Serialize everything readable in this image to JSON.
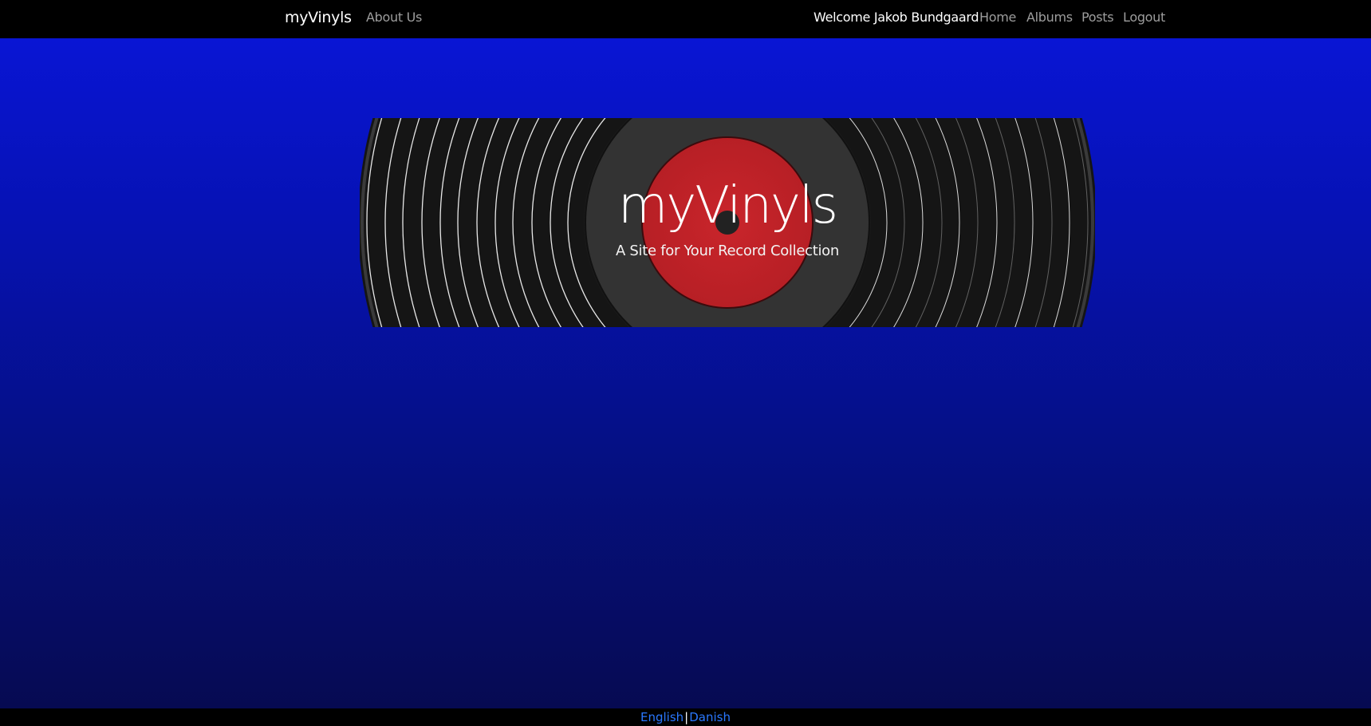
{
  "navbar": {
    "brand": "myVinyls",
    "about_label": "About Us",
    "welcome_text": "Welcome Jakob Bundgaard",
    "home_label": "Home",
    "albums_label": "Albums",
    "posts_label": "Posts",
    "logout_label": "Logout"
  },
  "hero": {
    "title": "myVinyls",
    "subtitle": "A Site for Your Record Collection",
    "icon": "vinyl-record-icon",
    "label_color": "#c1272d",
    "record_color": "#151515"
  },
  "footer": {
    "english_label": "English",
    "separator": "|",
    "danish_label": "Danish"
  },
  "colors": {
    "background_top": "#0a16db",
    "background_bottom": "#060a4e",
    "navbar": "#000000",
    "link": "#2a78ff"
  }
}
